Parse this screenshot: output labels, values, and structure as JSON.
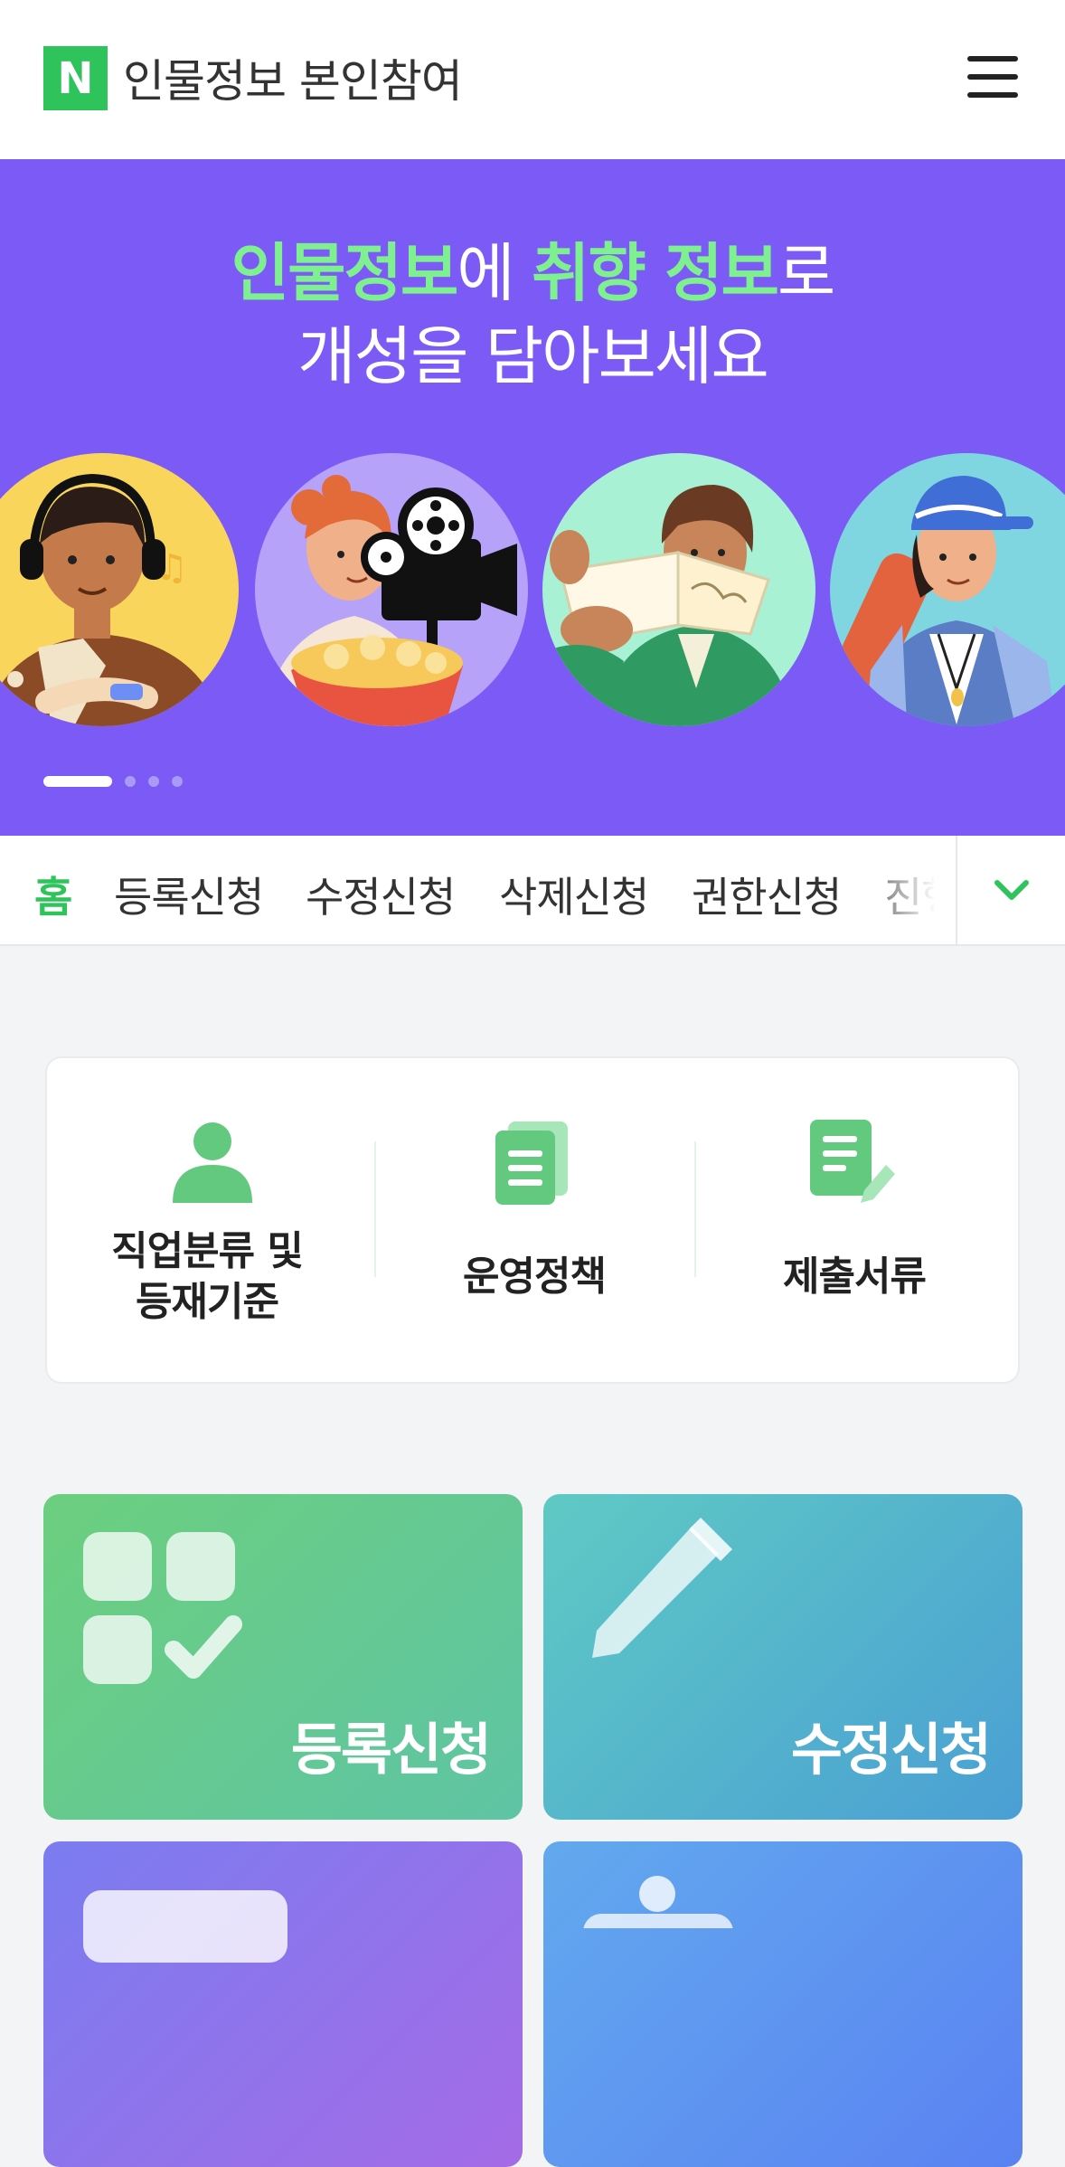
{
  "header": {
    "logo_letter": "N",
    "title": "인물정보 본인참여",
    "menu_icon": "hamburger-menu-icon"
  },
  "banner": {
    "line1_part1": "인물정보",
    "line1_part2": "에 ",
    "line1_part3": "취향 정보",
    "line1_part4": "로",
    "line2": "개성을 담아보세요",
    "slides_total": 4,
    "active_slide": 1,
    "illustrations": [
      "music-listener-illustration",
      "movie-fan-illustration",
      "book-reader-illustration",
      "hiker-illustration"
    ],
    "colors": {
      "background": "#7b5af5",
      "highlight": "#7ef08f"
    }
  },
  "tabs": {
    "items": [
      {
        "label": "홈",
        "active": true
      },
      {
        "label": "등록신청",
        "active": false
      },
      {
        "label": "수정신청",
        "active": false
      },
      {
        "label": "삭제신청",
        "active": false
      },
      {
        "label": "권한신청",
        "active": false
      },
      {
        "label": "진행",
        "active": false
      }
    ],
    "expand_icon": "chevron-down-icon"
  },
  "quick_links": [
    {
      "label_line1": "직업분류 및",
      "label_line2": "등재기준",
      "icon": "person-icon"
    },
    {
      "label_line1": "운영정책",
      "label_line2": "",
      "icon": "document-stack-icon"
    },
    {
      "label_line1": "제출서류",
      "label_line2": "",
      "icon": "document-edit-icon"
    }
  ],
  "tiles": [
    {
      "label": "등록신청",
      "icon": "grid-check-icon",
      "color_from": "#6ccf7e",
      "color_to": "#5ec4a4"
    },
    {
      "label": "수정신청",
      "icon": "pencil-icon",
      "color_from": "#5fcac4",
      "color_to": "#4a9fd4"
    },
    {
      "label": "",
      "icon": "card-icon",
      "color_from": "#7b7cf0",
      "color_to": "#a46be6"
    },
    {
      "label": "",
      "icon": "person-badge-icon",
      "color_from": "#62a9ee",
      "color_to": "#5a82f2"
    }
  ],
  "colors": {
    "accent": "#2fc35b",
    "page_bg": "#f3f4f5"
  }
}
